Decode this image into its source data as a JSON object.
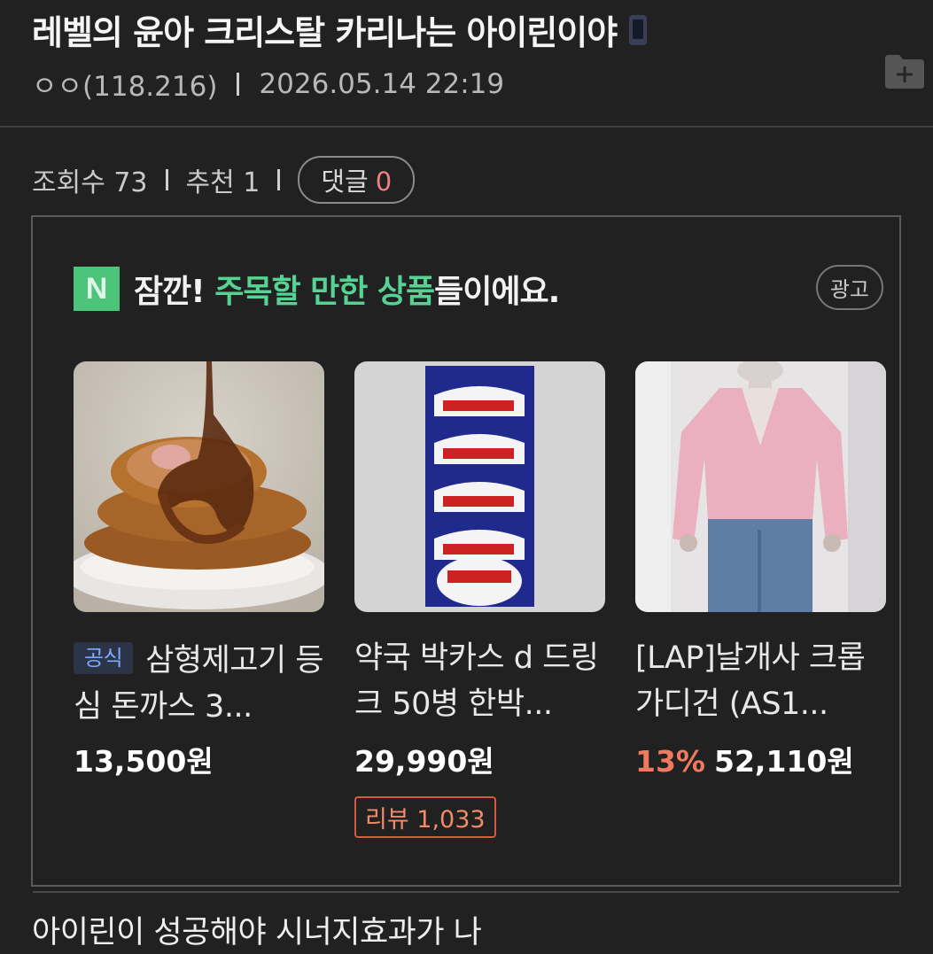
{
  "post": {
    "title": "레벨의 윤아 크리스탈 카리나는 아이린이야",
    "author": "ㅇㅇ(118.216)",
    "datetime": "2026.05.14 22:19",
    "views_label": "조회수 73",
    "likes_label": "추천 1",
    "comments_label": "댓글",
    "comments_count": "0",
    "body": "아이린이 성공해야 시너지효과가 나"
  },
  "ad": {
    "logo_letter": "N",
    "title_pre": "잠깐! ",
    "title_highlight": "주목할 만한 상품",
    "title_post": "들이에요.",
    "badge": "광고",
    "products": [
      {
        "official_badge": "공식",
        "name": "삼형제고기 등심 돈까스 3...",
        "price": "13,500원",
        "image": "pork-cutlet-image"
      },
      {
        "name": "약국 박카스 d 드링크 50병 한박...",
        "price": "29,990원",
        "review": "리뷰 1,033",
        "image": "bacchus-box-image"
      },
      {
        "name": "[LAP]날개사 크롭가디건 (AS1...",
        "discount": "13%",
        "price": "52,110원",
        "image": "pink-cardigan-image"
      }
    ]
  },
  "colors": {
    "background": "#212121",
    "highlight": "#55d393",
    "discount": "#f07a60",
    "naver_green": "#4cc57a"
  }
}
